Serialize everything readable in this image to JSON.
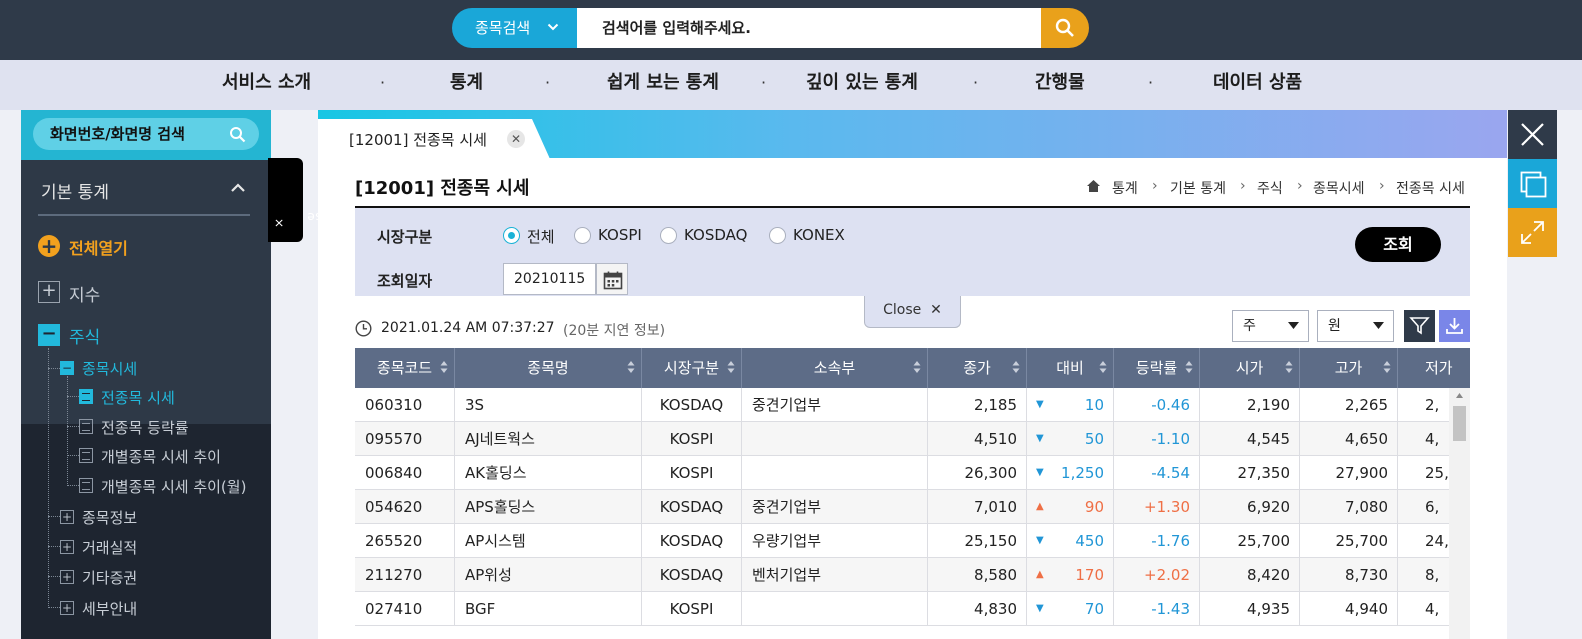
{
  "search": {
    "category_label": "종목검색",
    "placeholder": "검색어를 입력해주세요."
  },
  "nav": {
    "items": [
      "서비스 소개",
      "통계",
      "쉽게 보는 통계",
      "깊이 있는 통계",
      "간행물",
      "데이터 상품"
    ],
    "separator": "·"
  },
  "sidebar": {
    "search_label": "화면번호/화면명 검색",
    "section_title": "기본 통계",
    "open_all": "전체열기",
    "index": "지수",
    "stock": "주식",
    "market_price": "종목시세",
    "leaves": [
      "전종목 시세",
      "전종목 등락률",
      "개별종목 시세 추이",
      "개별종목 시세 추이(월)"
    ],
    "others": [
      "종목정보",
      "거래실적",
      "기타증권",
      "세부안내"
    ],
    "close_label": "Close"
  },
  "content": {
    "tab_label": "[12001] 전종목 시세",
    "page_title": "[12001] 전종목 시세",
    "breadcrumb": [
      "통계",
      "기본 통계",
      "주식",
      "종목시세",
      "전종목 시세"
    ]
  },
  "filter": {
    "market_label": "시장구분",
    "market_options": [
      "전체",
      "KOSPI",
      "KOSDAQ",
      "KONEX"
    ],
    "market_selected": "전체",
    "date_label": "조회일자",
    "date_value": "20210115",
    "query_button": "조회",
    "close_label": "Close"
  },
  "timestamp": {
    "text": "2021.01.24 AM 07:37:27",
    "note": "(20분 지연 정보)"
  },
  "selects": {
    "unit_share": "주",
    "unit_currency": "원"
  },
  "table": {
    "headers": [
      "종목코드",
      "종목명",
      "시장구분",
      "소속부",
      "종가",
      "대비",
      "등락률",
      "시가",
      "고가",
      "저가"
    ],
    "rows": [
      {
        "code": "060310",
        "name": "3S",
        "market": "KOSDAQ",
        "dept": "중견기업부",
        "close": "2,185",
        "dir": "down",
        "change": "10",
        "rate": "-0.46",
        "open": "2,190",
        "high": "2,265",
        "low": "2,"
      },
      {
        "code": "095570",
        "name": "AJ네트웍스",
        "market": "KOSPI",
        "dept": "",
        "close": "4,510",
        "dir": "down",
        "change": "50",
        "rate": "-1.10",
        "open": "4,545",
        "high": "4,650",
        "low": "4,"
      },
      {
        "code": "006840",
        "name": "AK홀딩스",
        "market": "KOSPI",
        "dept": "",
        "close": "26,300",
        "dir": "down",
        "change": "1,250",
        "rate": "-4.54",
        "open": "27,350",
        "high": "27,900",
        "low": "25,"
      },
      {
        "code": "054620",
        "name": "APS홀딩스",
        "market": "KOSDAQ",
        "dept": "중견기업부",
        "close": "7,010",
        "dir": "up",
        "change": "90",
        "rate": "+1.30",
        "open": "6,920",
        "high": "7,080",
        "low": "6,"
      },
      {
        "code": "265520",
        "name": "AP시스템",
        "market": "KOSDAQ",
        "dept": "우량기업부",
        "close": "25,150",
        "dir": "down",
        "change": "450",
        "rate": "-1.76",
        "open": "25,700",
        "high": "25,700",
        "low": "24,"
      },
      {
        "code": "211270",
        "name": "AP위성",
        "market": "KOSDAQ",
        "dept": "벤처기업부",
        "close": "8,580",
        "dir": "up",
        "change": "170",
        "rate": "+2.02",
        "open": "8,420",
        "high": "8,730",
        "low": "8,"
      },
      {
        "code": "027410",
        "name": "BGF",
        "market": "KOSPI",
        "dept": "",
        "close": "4,830",
        "dir": "down",
        "change": "70",
        "rate": "-1.43",
        "open": "4,935",
        "high": "4,940",
        "low": "4,"
      }
    ]
  },
  "colors": {
    "up": "#ef6f45",
    "down": "#2196d6",
    "accent": "#1aa7d8",
    "search_button": "#e9a11b"
  }
}
